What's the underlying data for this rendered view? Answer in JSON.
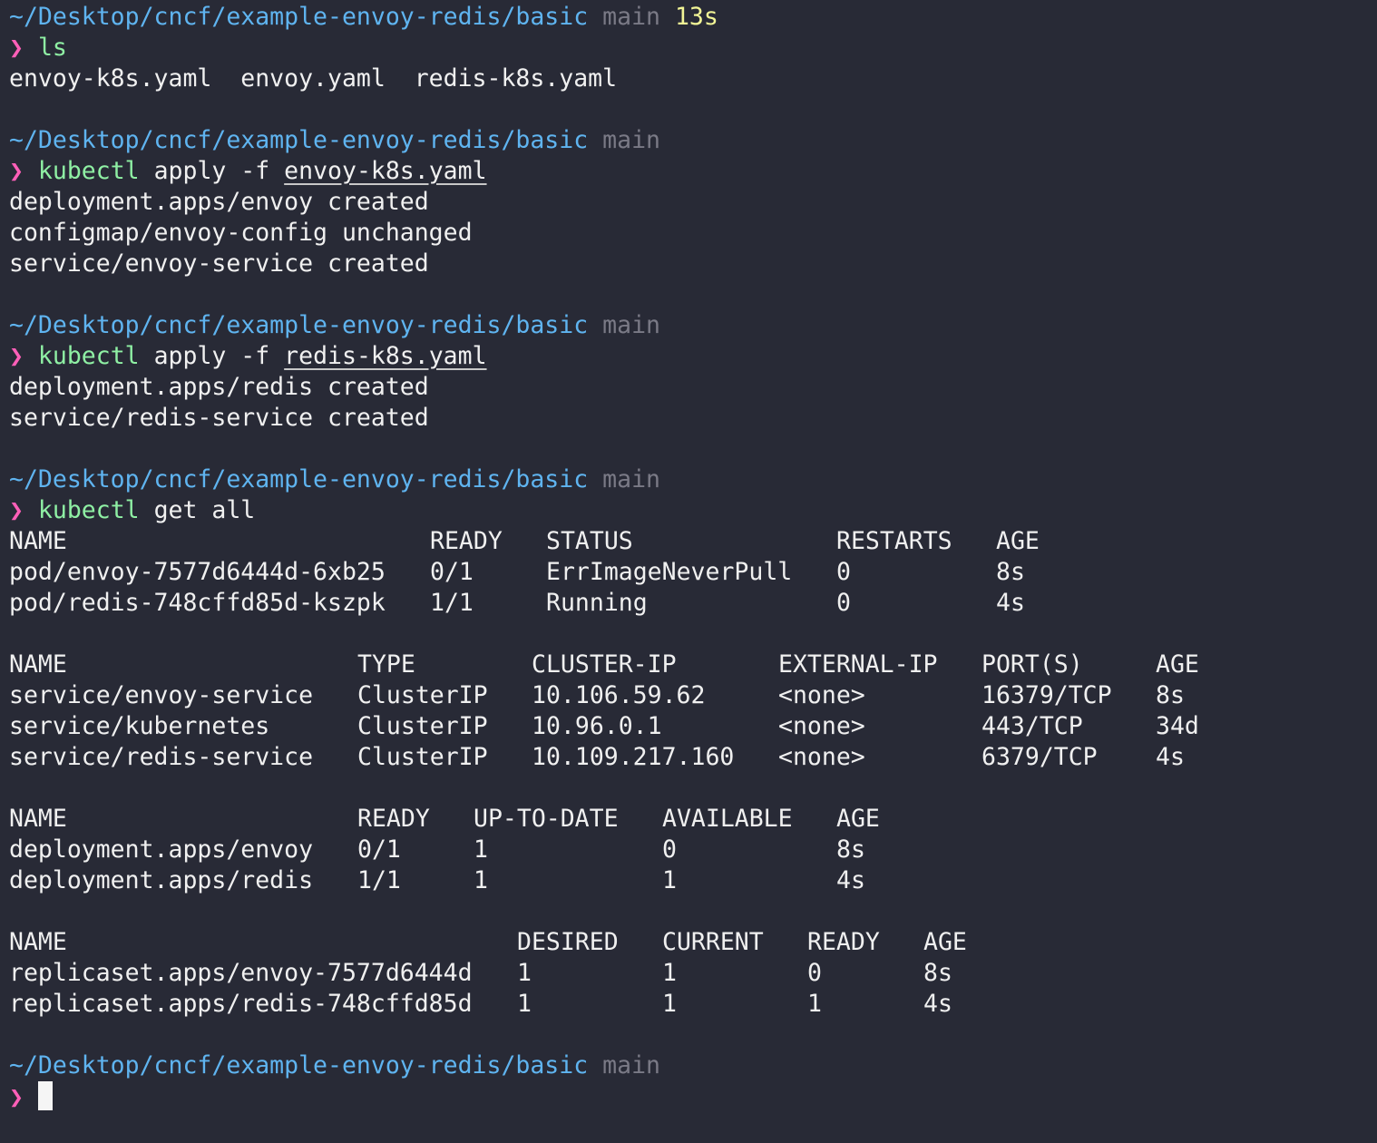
{
  "prompt": {
    "path": "~/Desktop/cncf/example-envoy-redis/basic",
    "branch": "main",
    "symbol": "❯"
  },
  "blocks": [
    {
      "duration": "13s",
      "command": "ls",
      "args": "",
      "file": "",
      "output": [
        "envoy-k8s.yaml  envoy.yaml  redis-k8s.yaml"
      ]
    },
    {
      "duration": "",
      "command": "kubectl",
      "args": " apply -f ",
      "file": "envoy-k8s.yaml",
      "output": [
        "deployment.apps/envoy created",
        "configmap/envoy-config unchanged",
        "service/envoy-service created"
      ]
    },
    {
      "duration": "",
      "command": "kubectl",
      "args": " apply -f ",
      "file": "redis-k8s.yaml",
      "output": [
        "deployment.apps/redis created",
        "service/redis-service created"
      ]
    },
    {
      "duration": "",
      "command": "kubectl",
      "args": " get all",
      "file": "",
      "output": []
    }
  ],
  "tables": [
    {
      "headers": [
        "NAME",
        "READY",
        "STATUS",
        "RESTARTS",
        "AGE"
      ],
      "rows": [
        [
          "pod/envoy-7577d6444d-6xb25",
          "0/1",
          "ErrImageNeverPull",
          "0",
          "8s"
        ],
        [
          "pod/redis-748cffd85d-kszpk",
          "1/1",
          "Running",
          "0",
          "4s"
        ]
      ]
    },
    {
      "headers": [
        "NAME",
        "TYPE",
        "CLUSTER-IP",
        "EXTERNAL-IP",
        "PORT(S)",
        "AGE"
      ],
      "rows": [
        [
          "service/envoy-service",
          "ClusterIP",
          "10.106.59.62",
          "<none>",
          "16379/TCP",
          "8s"
        ],
        [
          "service/kubernetes",
          "ClusterIP",
          "10.96.0.1",
          "<none>",
          "443/TCP",
          "34d"
        ],
        [
          "service/redis-service",
          "ClusterIP",
          "10.109.217.160",
          "<none>",
          "6379/TCP",
          "4s"
        ]
      ]
    },
    {
      "headers": [
        "NAME",
        "READY",
        "UP-TO-DATE",
        "AVAILABLE",
        "AGE"
      ],
      "rows": [
        [
          "deployment.apps/envoy",
          "0/1",
          "1",
          "0",
          "8s"
        ],
        [
          "deployment.apps/redis",
          "1/1",
          "1",
          "1",
          "4s"
        ]
      ]
    },
    {
      "headers": [
        "NAME",
        "DESIRED",
        "CURRENT",
        "READY",
        "AGE"
      ],
      "rows": [
        [
          "replicaset.apps/envoy-7577d6444d",
          "1",
          "1",
          "0",
          "8s"
        ],
        [
          "replicaset.apps/redis-748cffd85d",
          "1",
          "1",
          "1",
          "4s"
        ]
      ]
    }
  ]
}
